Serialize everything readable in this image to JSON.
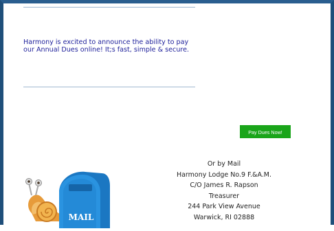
{
  "announcement": {
    "line1": "Harmony is excited to announce the ability to pay",
    "line2": "our Annual Dues online! It;s fast, simple & secure."
  },
  "pay_button": {
    "label": "Pay Dues Now!"
  },
  "mail": {
    "lines": [
      "Or by Mail",
      "Harmony Lodge No.9 F.&A.M.",
      "C/O James R. Rapson",
      "Treasurer",
      "244 Park View Avenue",
      "Warwick, RI 02888"
    ]
  },
  "illustration": {
    "mailbox_label": "MAIL",
    "icon": "snail-mailbox-illustration"
  },
  "colors": {
    "frame": "#1f4f7a",
    "announcement_text": "#1d1f9a",
    "button": "#1aa51a",
    "mailbox_blue": "#1b77c2"
  }
}
